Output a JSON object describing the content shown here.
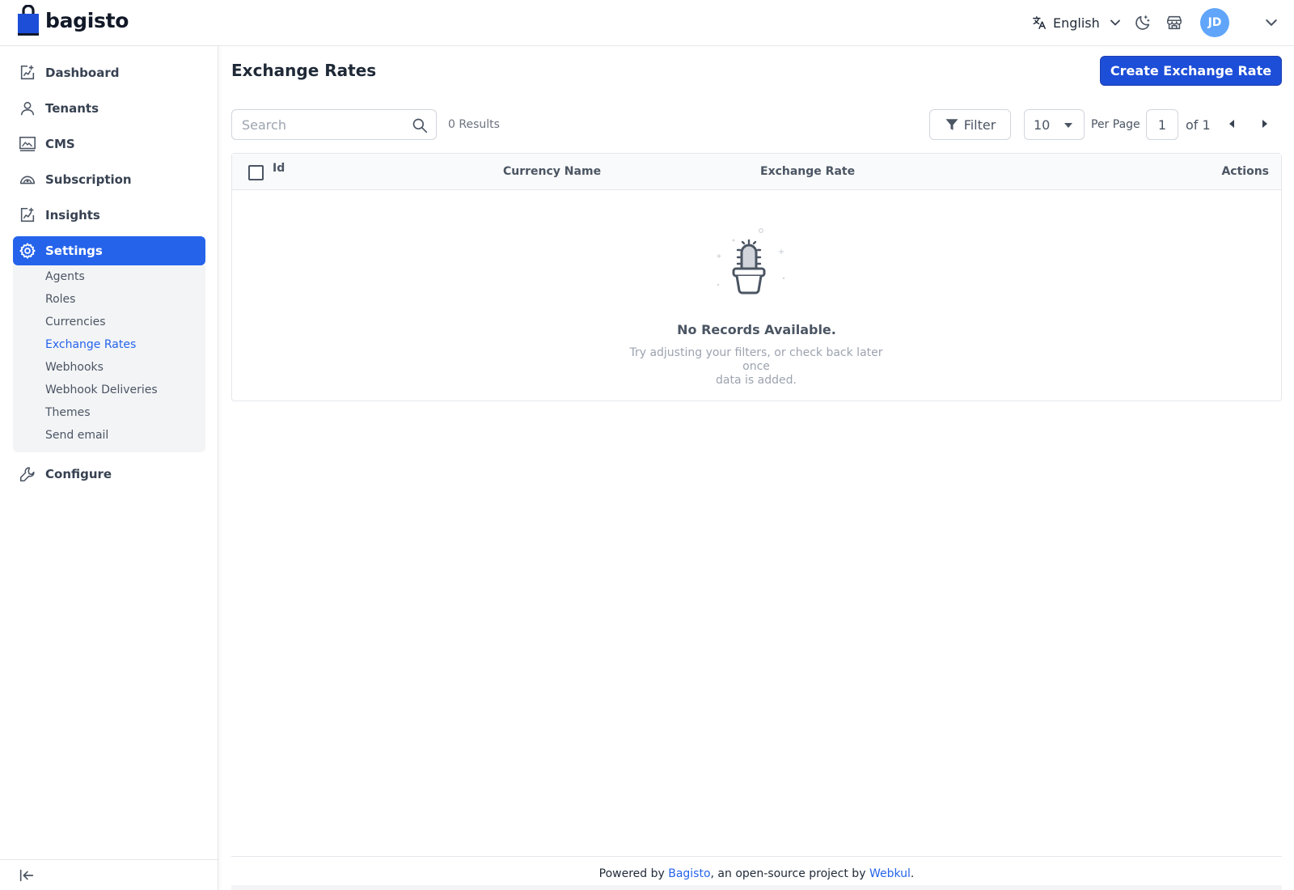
{
  "app": {
    "logo_text": "bagisto",
    "brand_color": "#2563eb"
  },
  "header": {
    "language": "English",
    "avatar_initials": "JD"
  },
  "sidebar": {
    "items": [
      {
        "label": "Dashboard",
        "icon": "dashboard-icon"
      },
      {
        "label": "Tenants",
        "icon": "user-icon"
      },
      {
        "label": "CMS",
        "icon": "image-icon"
      },
      {
        "label": "Subscription",
        "icon": "cloud-icon"
      },
      {
        "label": "Insights",
        "icon": "chart-icon"
      },
      {
        "label": "Settings",
        "icon": "gear-icon",
        "active": true
      },
      {
        "label": "Configure",
        "icon": "wrench-icon"
      }
    ],
    "settings_children": [
      {
        "label": "Agents"
      },
      {
        "label": "Roles"
      },
      {
        "label": "Currencies"
      },
      {
        "label": "Exchange Rates",
        "active": true
      },
      {
        "label": "Webhooks"
      },
      {
        "label": "Webhook Deliveries"
      },
      {
        "label": "Themes"
      },
      {
        "label": "Send email"
      }
    ]
  },
  "main": {
    "title": "Exchange Rates",
    "create_button": "Create Exchange Rate",
    "search": {
      "placeholder": "Search",
      "value": ""
    },
    "results": "0 Results",
    "filter_label": "Filter",
    "per_page": {
      "value": "10",
      "label": "Per Page"
    },
    "pagination": {
      "current": "1",
      "of": "of 1"
    },
    "columns": {
      "id": "Id",
      "currency_name": "Currency Name",
      "exchange_rate": "Exchange Rate",
      "actions": "Actions"
    },
    "empty": {
      "title": "No Records Available.",
      "description_line1": "Try adjusting your filters, or check back later once",
      "description_line2": "data is added."
    }
  },
  "footer": {
    "prefix": "Powered by ",
    "link1": "Bagisto",
    "middle": ", an open-source project by ",
    "link2": "Webkul",
    "suffix": "."
  }
}
